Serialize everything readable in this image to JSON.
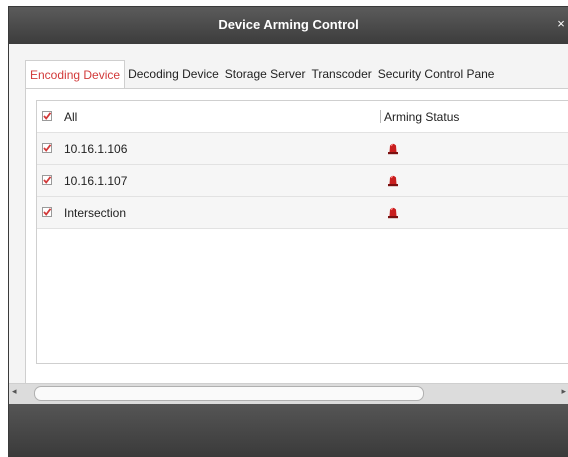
{
  "dialog": {
    "title": "Device Arming Control",
    "close_label": "×"
  },
  "tabs": [
    {
      "label": "Encoding Device",
      "active": true
    },
    {
      "label": "Decoding Device",
      "active": false
    },
    {
      "label": "Storage Server",
      "active": false
    },
    {
      "label": "Transcoder",
      "active": false
    },
    {
      "label": "Security Control Pane",
      "active": false
    }
  ],
  "table": {
    "header": {
      "select_all_label": "All",
      "checked": true,
      "status_column": "Arming Status"
    },
    "rows": [
      {
        "name": "10.16.1.106",
        "checked": true,
        "status_icon": "alarm-light-icon"
      },
      {
        "name": "10.16.1.107",
        "checked": true,
        "status_icon": "alarm-light-icon"
      },
      {
        "name": "Intersection",
        "checked": true,
        "status_icon": "alarm-light-icon"
      }
    ]
  },
  "scrollbar": {
    "left_arrow": "◂",
    "right_arrow": "▸"
  },
  "colors": {
    "accent": "#d23a3a",
    "titlebar": "#4a4a4a",
    "footer": "#484848",
    "alarm": "#c81e1e"
  }
}
